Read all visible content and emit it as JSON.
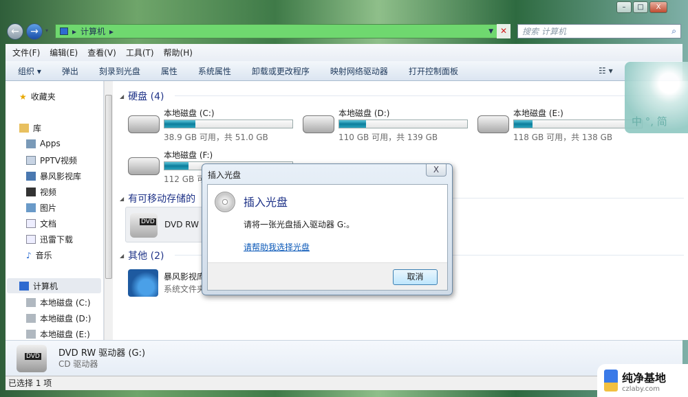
{
  "window": {
    "controls": {
      "minimize": "–",
      "maximize": "□",
      "close": "X"
    }
  },
  "address": {
    "root_icon": "computer-icon",
    "path": [
      "计算机"
    ],
    "search_placeholder": "搜索 计算机"
  },
  "menu": [
    "文件(F)",
    "编辑(E)",
    "查看(V)",
    "工具(T)",
    "帮助(H)"
  ],
  "toolbar": [
    "组织 ▾",
    "弹出",
    "刻录到光盘",
    "属性",
    "系统属性",
    "卸载或更改程序",
    "映射网络驱动器",
    "打开控制面板"
  ],
  "sidebar": {
    "favorites": "收藏夹",
    "library": "库",
    "library_items": [
      "Apps",
      "PPTV视频",
      "暴风影视库",
      "视频",
      "图片",
      "文档",
      "迅雷下载",
      "音乐"
    ],
    "computer": "计算机",
    "computer_items": [
      "本地磁盘 (C:)",
      "本地磁盘 (D:)",
      "本地磁盘 (E:)"
    ]
  },
  "groups": {
    "hdd": "硬盘 (4)",
    "removable": "有可移动存储的",
    "other": "其他 (2)"
  },
  "drives": [
    {
      "name": "本地磁盘 (C:)",
      "size": "38.9 GB 可用，共 51.0 GB",
      "used": 0.24
    },
    {
      "name": "本地磁盘 (D:)",
      "size": "110 GB 可用，共 139 GB",
      "used": 0.21
    },
    {
      "name": "本地磁盘 (E:)",
      "size": "118 GB 可用，共 138 GB",
      "used": 0.145
    },
    {
      "name": "本地磁盘 (F:)",
      "size": "112 GB 可",
      "used": 0.19
    }
  ],
  "removable": {
    "name": "DVD RW",
    "badge": "DVD"
  },
  "other": {
    "name": "暴风影视库",
    "sub": "系统文件夹"
  },
  "details": {
    "name": "DVD RW 驱动器 (G:)",
    "type": "CD 驱动器",
    "badge": "DVD"
  },
  "status": {
    "text": "已选择 1 项"
  },
  "dialog": {
    "title": "插入光盘",
    "heading": "插入光盘",
    "message": "请将一张光盘插入驱动器 G:。",
    "link": "请帮助我选择光盘",
    "cancel": "取消",
    "close": "X"
  },
  "overlay": {
    "text": "中 °, 简"
  },
  "watermark": {
    "title": "纯净基地",
    "url": "czlaby.com"
  },
  "colors": {
    "accent": "#1e3287",
    "bar": "#0c7e9c",
    "address": "#6fd86f"
  }
}
